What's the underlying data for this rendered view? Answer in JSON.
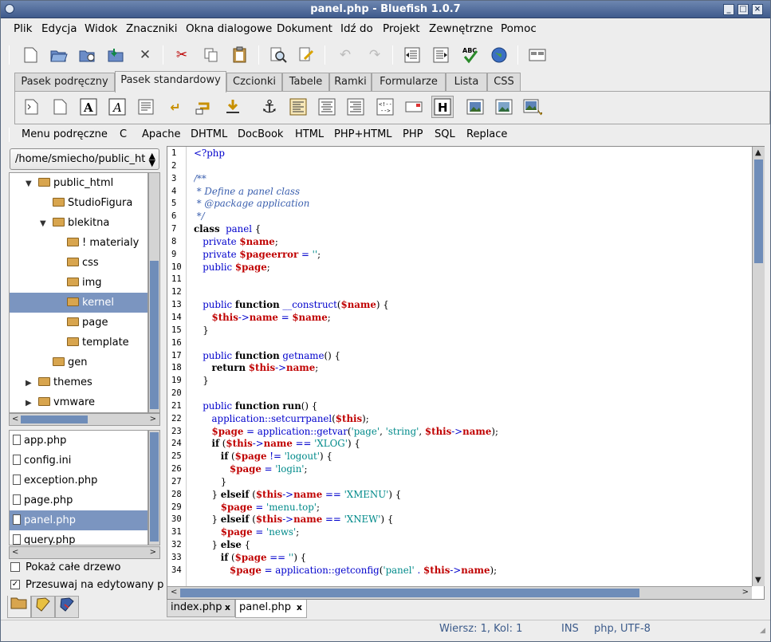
{
  "window": {
    "title": "panel.php - Bluefish 1.0.7"
  },
  "menu": [
    "Plik",
    "Edycja",
    "Widok",
    "Znaczniki",
    "Okna dialogowe",
    "Dokument",
    "Idź do",
    "Projekt",
    "Zewnętrzne",
    "Pomoc"
  ],
  "tabs": [
    "Pasek podręczny",
    "Pasek standardowy",
    "Czcionki",
    "Tabele",
    "Ramki",
    "Formularze",
    "Lista",
    "CSS"
  ],
  "active_tab": "Pasek standardowy",
  "custom_menu": [
    "Menu podręczne",
    "C",
    "Apache",
    "DHTML",
    "DocBook",
    "HTML",
    "PHP+HTML",
    "PHP",
    "SQL",
    "Replace"
  ],
  "sidebar": {
    "path": "/home/smiecho/public_ht",
    "tree": [
      {
        "label": "public_html",
        "expander": "▼"
      },
      {
        "label": "StudioFigura",
        "expander": ""
      },
      {
        "label": "blekitna",
        "expander": "▼"
      },
      {
        "label": "! materialy",
        "expander": ""
      },
      {
        "label": "css",
        "expander": ""
      },
      {
        "label": "img",
        "expander": ""
      },
      {
        "label": "kernel",
        "expander": "",
        "selected": true
      },
      {
        "label": "page",
        "expander": ""
      },
      {
        "label": "template",
        "expander": ""
      },
      {
        "label": "gen",
        "expander": ""
      },
      {
        "label": "themes",
        "expander": "▶"
      },
      {
        "label": "vmware",
        "expander": "▶"
      }
    ],
    "files": [
      {
        "label": "app.php"
      },
      {
        "label": "config.ini"
      },
      {
        "label": "exception.php"
      },
      {
        "label": "page.php"
      },
      {
        "label": "panel.php",
        "selected": true
      },
      {
        "label": "query.php"
      }
    ],
    "show_tree_label": "Pokaż całe drzewo",
    "show_tree_checked": false,
    "follow_label": "Przesuwaj na edytowany p",
    "follow_checked": true
  },
  "editor": {
    "line_numbers": [
      "1",
      "2",
      "3",
      "4",
      "5",
      "6",
      "7",
      "8",
      "9",
      "10",
      "11",
      "12",
      "13",
      "14",
      "15",
      "16",
      "17",
      "18",
      "19",
      "20",
      "21",
      "22",
      "23",
      "24",
      "25",
      "26",
      "27",
      "28",
      "29",
      "30",
      "31",
      "32",
      "33",
      "34"
    ],
    "lines": [
      [
        [
          "tk",
          "<?php"
        ]
      ],
      [],
      [
        [
          "cm",
          "/**"
        ]
      ],
      [
        [
          "cm",
          " * Define a panel class"
        ]
      ],
      [
        [
          "cm",
          " * @package application"
        ]
      ],
      [
        [
          "cm",
          " */"
        ]
      ],
      [
        [
          "kw",
          "class"
        ],
        [
          "",
          "  "
        ],
        [
          "fn",
          "panel"
        ],
        [
          "",
          " {"
        ]
      ],
      [
        [
          "",
          "   "
        ],
        [
          "tk",
          "private"
        ],
        [
          "",
          " "
        ],
        [
          "vr",
          "$name"
        ],
        [
          "",
          ";"
        ]
      ],
      [
        [
          "",
          "   "
        ],
        [
          "tk",
          "private"
        ],
        [
          "",
          " "
        ],
        [
          "vr",
          "$pageerror"
        ],
        [
          "",
          " "
        ],
        [
          "op",
          "="
        ],
        [
          "",
          " "
        ],
        [
          "st",
          "''"
        ],
        [
          "",
          ";"
        ]
      ],
      [
        [
          "",
          "   "
        ],
        [
          "tk",
          "public"
        ],
        [
          "",
          " "
        ],
        [
          "vr",
          "$page"
        ],
        [
          "",
          ";"
        ]
      ],
      [],
      [],
      [
        [
          "",
          "   "
        ],
        [
          "tk",
          "public"
        ],
        [
          "",
          " "
        ],
        [
          "kw",
          "function"
        ],
        [
          "",
          " "
        ],
        [
          "fn",
          "__construct"
        ],
        [
          "",
          "("
        ],
        [
          "vr",
          "$name"
        ],
        [
          "",
          ") {"
        ]
      ],
      [
        [
          "",
          "      "
        ],
        [
          "vr",
          "$this"
        ],
        [
          "op",
          "->"
        ],
        [
          "vr",
          "name"
        ],
        [
          "",
          " "
        ],
        [
          "op",
          "="
        ],
        [
          "",
          " "
        ],
        [
          "vr",
          "$name"
        ],
        [
          "",
          ";"
        ]
      ],
      [
        [
          "",
          "   }"
        ]
      ],
      [],
      [
        [
          "",
          "   "
        ],
        [
          "tk",
          "public"
        ],
        [
          "",
          " "
        ],
        [
          "kw",
          "function"
        ],
        [
          "",
          " "
        ],
        [
          "fn",
          "getname"
        ],
        [
          "",
          "() {"
        ]
      ],
      [
        [
          "",
          "      "
        ],
        [
          "kw",
          "return"
        ],
        [
          "",
          " "
        ],
        [
          "vr",
          "$this"
        ],
        [
          "op",
          "->"
        ],
        [
          "vr",
          "name"
        ],
        [
          "",
          ";"
        ]
      ],
      [
        [
          "",
          "   }"
        ]
      ],
      [],
      [
        [
          "",
          "   "
        ],
        [
          "tk",
          "public"
        ],
        [
          "",
          " "
        ],
        [
          "kw",
          "function"
        ],
        [
          "",
          " "
        ],
        [
          "kw",
          "run"
        ],
        [
          "",
          "() {"
        ]
      ],
      [
        [
          "",
          "      "
        ],
        [
          "fn",
          "application::setcurrpanel"
        ],
        [
          "",
          "("
        ],
        [
          "vr",
          "$this"
        ],
        [
          "",
          ");"
        ]
      ],
      [
        [
          "",
          "      "
        ],
        [
          "vr",
          "$page"
        ],
        [
          "",
          " "
        ],
        [
          "op",
          "="
        ],
        [
          "",
          " "
        ],
        [
          "fn",
          "application::getvar"
        ],
        [
          "",
          "("
        ],
        [
          "st",
          "'page'"
        ],
        [
          "",
          ", "
        ],
        [
          "st",
          "'string'"
        ],
        [
          "",
          ", "
        ],
        [
          "vr",
          "$this"
        ],
        [
          "op",
          "->"
        ],
        [
          "vr",
          "name"
        ],
        [
          "",
          ");"
        ]
      ],
      [
        [
          "",
          "      "
        ],
        [
          "kw",
          "if"
        ],
        [
          "",
          " ("
        ],
        [
          "vr",
          "$this"
        ],
        [
          "op",
          "->"
        ],
        [
          "vr",
          "name"
        ],
        [
          "",
          " "
        ],
        [
          "op",
          "=="
        ],
        [
          "",
          " "
        ],
        [
          "st",
          "'XLOG'"
        ],
        [
          "",
          ") {"
        ]
      ],
      [
        [
          "",
          "         "
        ],
        [
          "kw",
          "if"
        ],
        [
          "",
          " ("
        ],
        [
          "vr",
          "$page"
        ],
        [
          "",
          " "
        ],
        [
          "op",
          "!="
        ],
        [
          "",
          " "
        ],
        [
          "st",
          "'logout'"
        ],
        [
          "",
          ") {"
        ]
      ],
      [
        [
          "",
          "            "
        ],
        [
          "vr",
          "$page"
        ],
        [
          "",
          " "
        ],
        [
          "op",
          "="
        ],
        [
          "",
          " "
        ],
        [
          "st",
          "'login'"
        ],
        [
          "",
          ";"
        ]
      ],
      [
        [
          "",
          "         }"
        ]
      ],
      [
        [
          "",
          "      } "
        ],
        [
          "kw",
          "elseif"
        ],
        [
          "",
          " ("
        ],
        [
          "vr",
          "$this"
        ],
        [
          "op",
          "->"
        ],
        [
          "vr",
          "name"
        ],
        [
          "",
          " "
        ],
        [
          "op",
          "=="
        ],
        [
          "",
          " "
        ],
        [
          "st",
          "'XMENU'"
        ],
        [
          "",
          ") {"
        ]
      ],
      [
        [
          "",
          "         "
        ],
        [
          "vr",
          "$page"
        ],
        [
          "",
          " "
        ],
        [
          "op",
          "="
        ],
        [
          "",
          " "
        ],
        [
          "st",
          "'menu.top'"
        ],
        [
          "",
          ";"
        ]
      ],
      [
        [
          "",
          "      } "
        ],
        [
          "kw",
          "elseif"
        ],
        [
          "",
          " ("
        ],
        [
          "vr",
          "$this"
        ],
        [
          "op",
          "->"
        ],
        [
          "vr",
          "name"
        ],
        [
          "",
          " "
        ],
        [
          "op",
          "=="
        ],
        [
          "",
          " "
        ],
        [
          "st",
          "'XNEW'"
        ],
        [
          "",
          ") {"
        ]
      ],
      [
        [
          "",
          "         "
        ],
        [
          "vr",
          "$page"
        ],
        [
          "",
          " "
        ],
        [
          "op",
          "="
        ],
        [
          "",
          " "
        ],
        [
          "st",
          "'news'"
        ],
        [
          "",
          ";"
        ]
      ],
      [
        [
          "",
          "      } "
        ],
        [
          "kw",
          "else"
        ],
        [
          "",
          " {"
        ]
      ],
      [
        [
          "",
          "         "
        ],
        [
          "kw",
          "if"
        ],
        [
          "",
          " ("
        ],
        [
          "vr",
          "$page"
        ],
        [
          "",
          " "
        ],
        [
          "op",
          "=="
        ],
        [
          "",
          " "
        ],
        [
          "st",
          "''"
        ],
        [
          "",
          ") {"
        ]
      ],
      [
        [
          "",
          "            "
        ],
        [
          "vr",
          "$page"
        ],
        [
          "",
          " "
        ],
        [
          "op",
          "="
        ],
        [
          "",
          " "
        ],
        [
          "fn",
          "application::getconfig"
        ],
        [
          "",
          "("
        ],
        [
          "st",
          "'panel'"
        ],
        [
          "",
          " "
        ],
        [
          "op",
          "."
        ],
        [
          "",
          " "
        ],
        [
          "vr",
          "$this"
        ],
        [
          "op",
          "->"
        ],
        [
          "vr",
          "name"
        ],
        [
          "",
          ");"
        ]
      ]
    ]
  },
  "doc_tabs": [
    {
      "label": "index.php",
      "close": "x"
    },
    {
      "label": "panel.php",
      "close": "x",
      "active": true
    }
  ],
  "status": {
    "position": "Wiersz: 1, Kol: 1",
    "mode": "INS",
    "encoding": "php, UTF-8"
  },
  "colors": {
    "selection": "#7b95c0",
    "scroll_thumb": "#6f8db9",
    "title_bar": "#4a6699",
    "php_variable": "#c00000",
    "php_keyword": "#0000cc",
    "php_string": "#008a8a",
    "php_comment": "#3a5fae"
  },
  "toolbar_icons": [
    "new-file-icon",
    "open-icon",
    "open-advanced-icon",
    "save-icon",
    "close-icon",
    "cut-icon",
    "copy-icon",
    "paste-icon",
    "find-icon",
    "replace-icon",
    "undo-icon",
    "redo-icon",
    "shift-left-icon",
    "shift-right-icon",
    "spellcheck-icon",
    "browser-preview-icon",
    "fullscreen-icon"
  ]
}
